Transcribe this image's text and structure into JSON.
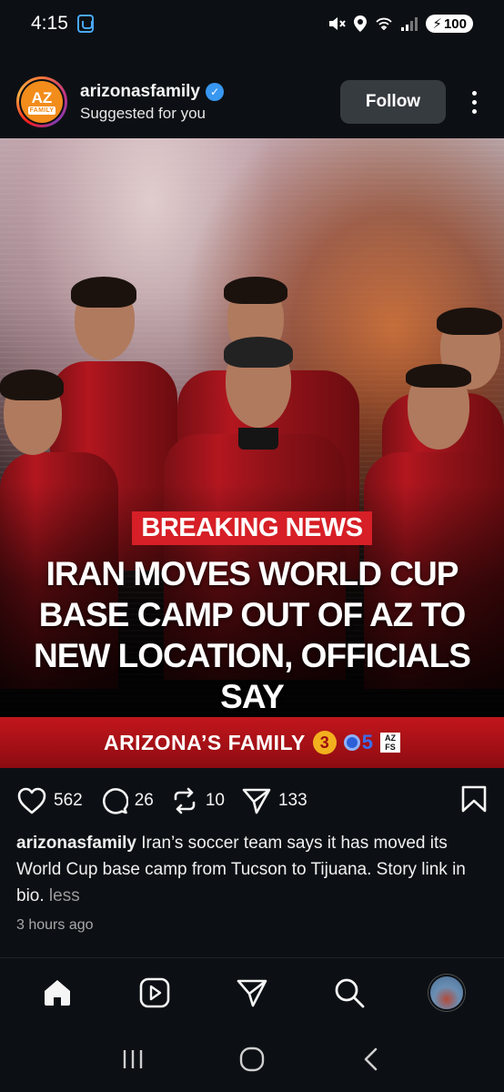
{
  "status_bar": {
    "time": "4:15",
    "battery": "100"
  },
  "post": {
    "account": {
      "username": "arizonasfamily",
      "subtitle": "Suggested for you",
      "avatar_line1": "AZ",
      "avatar_line2": "FAMILY",
      "verified": true
    },
    "follow_label": "Follow",
    "image": {
      "badge": "BREAKING NEWS",
      "headline": "IRAN MOVES WORLD CUP BASE CAMP OUT OF AZ TO NEW LOCATION, OFFICIALS SAY",
      "brand": "ARIZONA’S FAMILY",
      "logo_three": "3",
      "logo_five": "5",
      "logo_azfs_top": "AZ",
      "logo_azfs_bottom": "FS"
    },
    "stats": {
      "likes": "562",
      "comments": "26",
      "reposts": "10",
      "shares": "133"
    },
    "caption": {
      "username": "arizonasfamily",
      "text": " Iran’s soccer team says it has moved its World Cup base camp from Tucson to Tijuana. Story link in bio. ",
      "less": "less"
    },
    "timestamp": "3 hours ago"
  },
  "colors": {
    "background": "#0c1014",
    "breaking_red": "#d61f26",
    "verified_blue": "#3897f0",
    "follow_button": "#363b40"
  },
  "icons": {
    "nav": [
      "home-icon",
      "reels-icon",
      "send-icon",
      "search-icon",
      "profile-avatar"
    ],
    "system": [
      "recent-apps-icon",
      "home-circle-icon",
      "back-icon"
    ]
  }
}
